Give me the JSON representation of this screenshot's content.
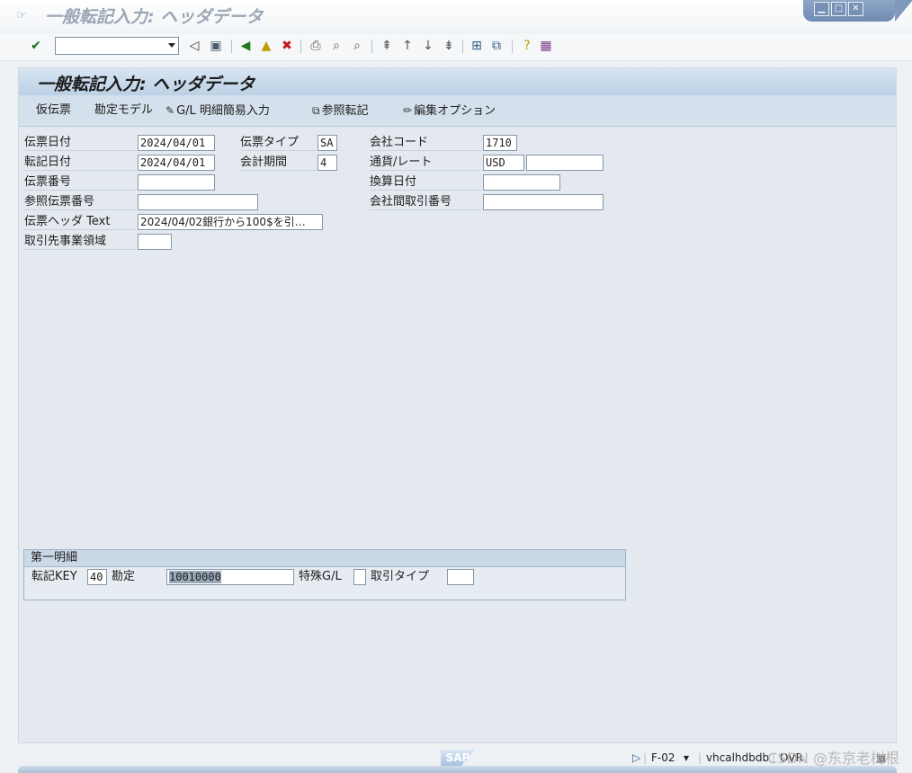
{
  "window": {
    "title": "一般転記入力: ヘッダデータ"
  },
  "toolbar": {
    "command_value": ""
  },
  "screen": {
    "title": "一般転記入力: ヘッダデータ",
    "app_buttons": [
      {
        "label": "仮伝票"
      },
      {
        "label": "勘定モデル"
      },
      {
        "label": "G/L 明細簡易入力"
      },
      {
        "label": "参照転記"
      },
      {
        "label": "編集オプション"
      }
    ]
  },
  "form": {
    "doc_date": {
      "label": "伝票日付",
      "value": "2024/04/01"
    },
    "post_date": {
      "label": "転記日付",
      "value": "2024/04/01"
    },
    "doc_number": {
      "label": "伝票番号",
      "value": ""
    },
    "ref_doc": {
      "label": "参照伝票番号",
      "value": ""
    },
    "header_text": {
      "label": "伝票ヘッダ Text",
      "value": "2024/04/02銀行から100$を引…"
    },
    "trading_partner": {
      "label": "取引先事業領域",
      "value": ""
    },
    "doc_type": {
      "label": "伝票タイプ",
      "value": "SA"
    },
    "period": {
      "label": "会計期間",
      "value": "4"
    },
    "company_code": {
      "label": "会社コード",
      "value": "1710"
    },
    "currency": {
      "label": "通貨/レート",
      "value": "USD",
      "rate": ""
    },
    "translation_date": {
      "label": "換算日付",
      "value": ""
    },
    "intercompany": {
      "label": "会社間取引番号",
      "value": ""
    }
  },
  "first_line": {
    "title": "第一明細",
    "posting_key_label": "転記KEY",
    "posting_key": "40",
    "account_label": "勘定",
    "account": "10010000",
    "special_gl_label": "特殊G/L",
    "special_gl": "",
    "transaction_type_label": "取引タイプ",
    "transaction_type": ""
  },
  "statusbar": {
    "logo": "SAP",
    "transaction": "F-02",
    "server": "vhcalhdbdb",
    "mode": "OVR"
  },
  "watermark": "CSDN @东京老树根",
  "colors": {
    "header_gradient": "#bcd1e5",
    "screen_bg": "#e3e9ef",
    "selected_text_bg": "#9aa9ba"
  }
}
